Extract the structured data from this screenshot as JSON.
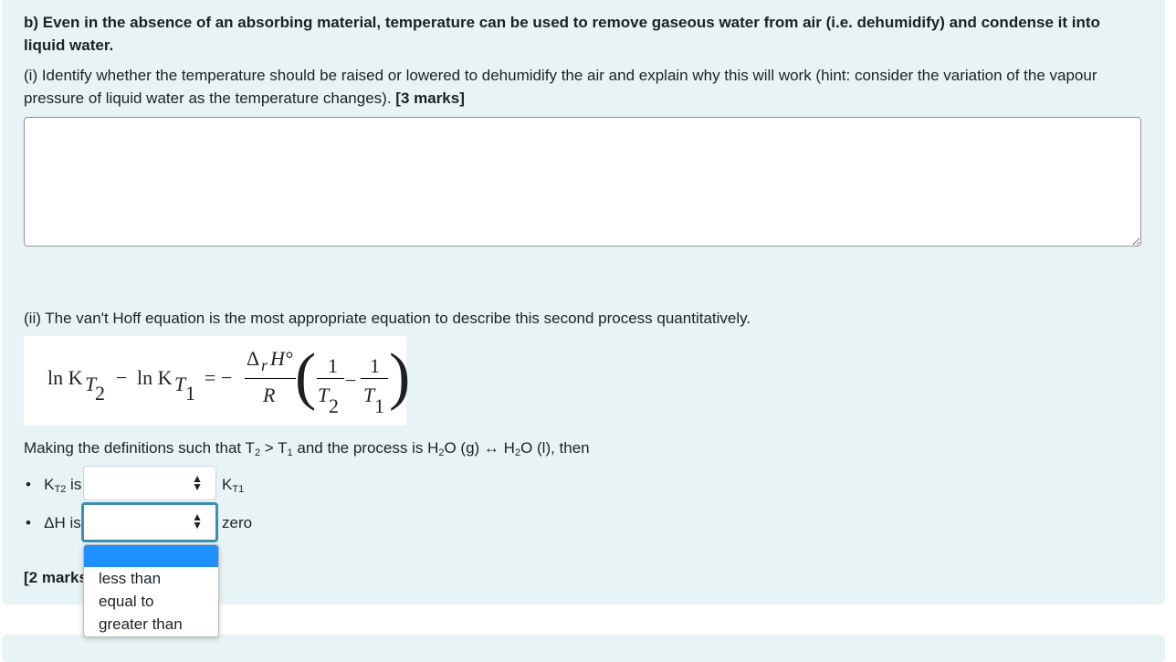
{
  "question": {
    "title": "b) Even in the absence of an absorbing material, temperature can be used to remove gaseous water from air (i.e. dehumidify) and condense it into liquid water.",
    "part_i": "(i) Identify whether the temperature should be raised or lowered to dehumidify the air and explain why this will work (hint: consider the variation of the vapour pressure of liquid water as the temperature changes).",
    "part_i_marks": "[3 marks]",
    "answer_value": "",
    "part_ii": "(ii) The van't Hoff equation is the most appropriate equation to describe this second process quantitatively.",
    "equation": {
      "lhs1": "ln K",
      "sub1": "T",
      "subsub1": "2",
      "minus": "−",
      "lhs2": "ln K",
      "sub2": "T",
      "subsub2": "1",
      "eq": "= −",
      "num": "Δ",
      "r": "r",
      "h": "H°",
      "den": "R",
      "one": "1",
      "t2": "T",
      "t2s": "2",
      "t1": "T",
      "t1s": "1"
    },
    "definition_pre": "Making the definitions such that T",
    "definition_mid": " > T",
    "definition_post": " and the process is H",
    "definition_g": "O (g) ↔ H",
    "definition_end": "O (l), then",
    "sub2": "2",
    "sub1": "1",
    "bullet1_pre": "K",
    "bullet1_sub": "T2",
    "bullet1_is": " is",
    "bullet1_after": "K",
    "bullet1_after_sub": "T1",
    "bullet2_pre": "ΔH is",
    "bullet2_after": "zero",
    "select1_value": "",
    "select2_value": "",
    "options": [
      "",
      "less than",
      "equal to",
      "greater than"
    ],
    "marks": "[2 marks]"
  },
  "colors": {
    "panel": "#e7f3f5",
    "focus": "#3b8fb0",
    "highlight": "#1e90ff"
  }
}
